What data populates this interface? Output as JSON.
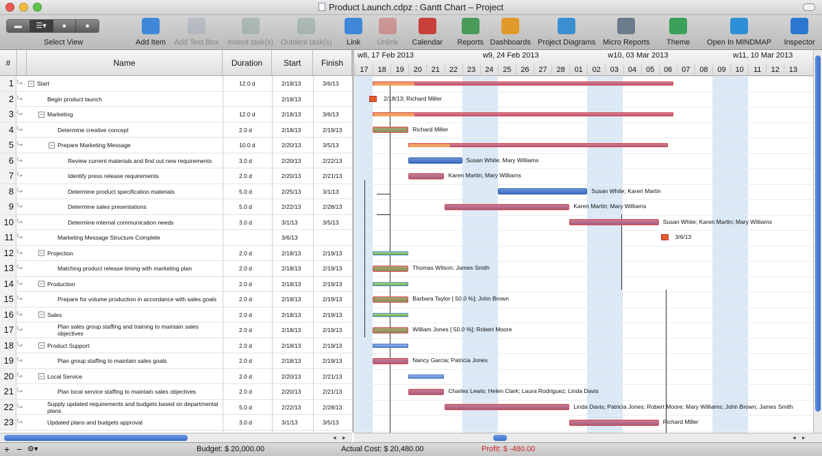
{
  "window": {
    "title": "Product Launch.cdpz : Gantt Chart – Project"
  },
  "toolbar": {
    "select_view": "Select View",
    "items": [
      {
        "label": "Add Item",
        "enabled": true
      },
      {
        "label": "Add Text Box",
        "enabled": false
      },
      {
        "label": "Indent task(s)",
        "enabled": false
      },
      {
        "label": "Outdent task(s)",
        "enabled": false
      },
      {
        "label": "Link",
        "enabled": true
      },
      {
        "label": "Unlink",
        "enabled": false
      },
      {
        "label": "Calendar",
        "enabled": true
      },
      {
        "label": "Reports",
        "enabled": true
      },
      {
        "label": "Dashboards",
        "enabled": true
      },
      {
        "label": "Project Diagrams",
        "enabled": true
      },
      {
        "label": "Micro Reports",
        "enabled": true
      },
      {
        "label": "Theme",
        "enabled": true
      },
      {
        "label": "Open In MINDMAP",
        "enabled": true
      },
      {
        "label": "Inspector",
        "enabled": true
      }
    ]
  },
  "table": {
    "columns": {
      "num": "#",
      "name": "Name",
      "duration": "Duration",
      "start": "Start",
      "finish": "Finish"
    },
    "rows": [
      {
        "n": "1",
        "name": "Start",
        "dur": "12.0 d",
        "start": "2/18/13",
        "finish": "3/6/13",
        "lvl": 0,
        "toggle": true
      },
      {
        "n": "2",
        "name": "Begin product launch",
        "dur": "",
        "start": "2/18/13",
        "finish": "",
        "lvl": 1,
        "toggle": false
      },
      {
        "n": "3",
        "name": "Marketing",
        "dur": "12.0 d",
        "start": "2/18/13",
        "finish": "3/6/13",
        "lvl": 1,
        "toggle": true
      },
      {
        "n": "4",
        "name": "Determine creative concept",
        "dur": "2.0 d",
        "start": "2/18/13",
        "finish": "2/19/13",
        "lvl": 2,
        "toggle": false
      },
      {
        "n": "5",
        "name": "Prepare Marketing Message",
        "dur": "10.0 d",
        "start": "2/20/13",
        "finish": "3/5/13",
        "lvl": 2,
        "toggle": true
      },
      {
        "n": "6",
        "name": "Review current materials and find out new requirements",
        "dur": "3.0 d",
        "start": "2/20/13",
        "finish": "2/22/13",
        "lvl": 3,
        "toggle": false
      },
      {
        "n": "7",
        "name": "Identify press release requirements",
        "dur": "2.0 d",
        "start": "2/20/13",
        "finish": "2/21/13",
        "lvl": 3,
        "toggle": false
      },
      {
        "n": "8",
        "name": "Determine product specification materials",
        "dur": "5.0 d",
        "start": "2/25/13",
        "finish": "3/1/13",
        "lvl": 3,
        "toggle": false
      },
      {
        "n": "9",
        "name": "Determine sales presentations",
        "dur": "5.0 d",
        "start": "2/22/13",
        "finish": "2/28/13",
        "lvl": 3,
        "toggle": false
      },
      {
        "n": "10",
        "name": "Determine internal communication needs",
        "dur": "3.0 d",
        "start": "3/1/13",
        "finish": "3/5/13",
        "lvl": 3,
        "toggle": false
      },
      {
        "n": "11",
        "name": "Marketing Message Structure Complete",
        "dur": "",
        "start": "3/6/13",
        "finish": "",
        "lvl": 2,
        "toggle": false
      },
      {
        "n": "12",
        "name": "Projection",
        "dur": "2.0 d",
        "start": "2/18/13",
        "finish": "2/19/13",
        "lvl": 1,
        "toggle": true
      },
      {
        "n": "13",
        "name": "Matching product release timing with marketing plan",
        "dur": "2.0 d",
        "start": "2/18/13",
        "finish": "2/19/13",
        "lvl": 2,
        "toggle": false
      },
      {
        "n": "14",
        "name": "Production",
        "dur": "2.0 d",
        "start": "2/18/13",
        "finish": "2/19/13",
        "lvl": 1,
        "toggle": true
      },
      {
        "n": "15",
        "name": "Prepare for volume production in accordance with sales goals",
        "dur": "2.0 d",
        "start": "2/18/13",
        "finish": "2/19/13",
        "lvl": 2,
        "toggle": false
      },
      {
        "n": "16",
        "name": "Sales",
        "dur": "2.0 d",
        "start": "2/18/13",
        "finish": "2/19/13",
        "lvl": 1,
        "toggle": true
      },
      {
        "n": "17",
        "name": "Plan sales group staffing and training to maintain sales objectives",
        "dur": "2.0 d",
        "start": "2/18/13",
        "finish": "2/19/13",
        "lvl": 2,
        "toggle": false
      },
      {
        "n": "18",
        "name": "Product Support",
        "dur": "2.0 d",
        "start": "2/18/13",
        "finish": "2/19/13",
        "lvl": 1,
        "toggle": true
      },
      {
        "n": "19",
        "name": "Plan group staffing to maintain sales goals",
        "dur": "2.0 d",
        "start": "2/18/13",
        "finish": "2/19/13",
        "lvl": 2,
        "toggle": false
      },
      {
        "n": "20",
        "name": "Local Service",
        "dur": "2.0 d",
        "start": "2/20/13",
        "finish": "2/21/13",
        "lvl": 1,
        "toggle": true
      },
      {
        "n": "21",
        "name": "Plan local service staffing to maintain sales objectives",
        "dur": "2.0 d",
        "start": "2/20/13",
        "finish": "2/21/13",
        "lvl": 2,
        "toggle": false
      },
      {
        "n": "22",
        "name": "Supply updated requirements and budgets based on departmental plans",
        "dur": "5.0 d",
        "start": "2/22/13",
        "finish": "2/28/13",
        "lvl": 1,
        "toggle": false
      },
      {
        "n": "23",
        "name": "Updated plans and budgets approval",
        "dur": "3.0 d",
        "start": "3/1/13",
        "finish": "3/5/13",
        "lvl": 1,
        "toggle": false
      }
    ]
  },
  "gantt": {
    "weeks": [
      {
        "label": "w8, 17 Feb 2013",
        "day": 0
      },
      {
        "label": "w9, 24 Feb 2013",
        "day": 7
      },
      {
        "label": "w10, 03 Mar 2013",
        "day": 14
      },
      {
        "label": "w11, 10 Mar 2013",
        "day": 21
      }
    ],
    "days": [
      "17",
      "18",
      "19",
      "20",
      "21",
      "22",
      "23",
      "24",
      "25",
      "26",
      "27",
      "28",
      "01",
      "02",
      "03",
      "04",
      "05",
      "06",
      "07",
      "08",
      "09",
      "10",
      "11",
      "12",
      "13"
    ],
    "weekend_days": [
      0,
      6,
      7,
      13,
      14,
      20,
      21
    ],
    "bars": [
      {
        "row": 0,
        "type": "sum",
        "start": 1,
        "end": 17.8,
        "label": ""
      },
      {
        "row": 1,
        "type": "ms",
        "start": 1,
        "label": "2/18/13; Richard Miller"
      },
      {
        "row": 2,
        "type": "sum",
        "start": 1,
        "end": 17.8,
        "label": ""
      },
      {
        "row": 3,
        "type": "done",
        "start": 1,
        "end": 3,
        "label": "Richard Miller"
      },
      {
        "row": 4,
        "type": "sum",
        "start": 3,
        "end": 17.5,
        "label": ""
      },
      {
        "row": 5,
        "type": "blue",
        "start": 3,
        "end": 6,
        "label": "Susan White; Mary Williams"
      },
      {
        "row": 6,
        "type": "task",
        "start": 3,
        "end": 5,
        "label": "Karen Martin; Mary Williams"
      },
      {
        "row": 7,
        "type": "blue",
        "start": 8,
        "end": 13,
        "label": "Susan White; Karen Martin"
      },
      {
        "row": 8,
        "type": "task",
        "start": 5,
        "end": 12,
        "label": "Karen Martin; Mary Williams"
      },
      {
        "row": 9,
        "type": "task",
        "start": 12,
        "end": 17,
        "label": "Susan White; Karen Martin; Mary Williams"
      },
      {
        "row": 10,
        "type": "ms",
        "start": 17.3,
        "label": "3/6/13"
      },
      {
        "row": 11,
        "type": "sumg",
        "start": 1,
        "end": 3,
        "label": ""
      },
      {
        "row": 12,
        "type": "done",
        "start": 1,
        "end": 3,
        "label": "Thomas Wilson; James Smith"
      },
      {
        "row": 13,
        "type": "sumg",
        "start": 1,
        "end": 3,
        "label": ""
      },
      {
        "row": 14,
        "type": "done",
        "start": 1,
        "end": 3,
        "label": "Barbara Taylor [ 50.0 %]; John Brown"
      },
      {
        "row": 15,
        "type": "sumg",
        "start": 1,
        "end": 3,
        "label": ""
      },
      {
        "row": 16,
        "type": "done",
        "start": 1,
        "end": 3,
        "label": "William Jones [ 50.0 %]; Robert Moore"
      },
      {
        "row": 17,
        "type": "sumb",
        "start": 1,
        "end": 3,
        "label": ""
      },
      {
        "row": 18,
        "type": "task",
        "start": 1,
        "end": 3,
        "label": "Nancy Garcia; Patricia Jones"
      },
      {
        "row": 19,
        "type": "sumb",
        "start": 3,
        "end": 5,
        "label": ""
      },
      {
        "row": 20,
        "type": "task",
        "start": 3,
        "end": 5,
        "label": "Charles Lewis; Helen Clark; Laura Rodriguez; Linda Davis"
      },
      {
        "row": 21,
        "type": "task",
        "start": 5,
        "end": 12,
        "label": "Linda Davis; Patricia Jones; Robert Moore; Mary Williams; John Brown; James Smith"
      },
      {
        "row": 22,
        "type": "task",
        "start": 12,
        "end": 17,
        "label": "Richard Miller"
      }
    ]
  },
  "status": {
    "budget": "Budget: $ 20,000.00",
    "actual": "Actual Cost: $ 20,480.00",
    "profit": "Profit: $ -480.00",
    "profit_color": "#cc2222"
  }
}
